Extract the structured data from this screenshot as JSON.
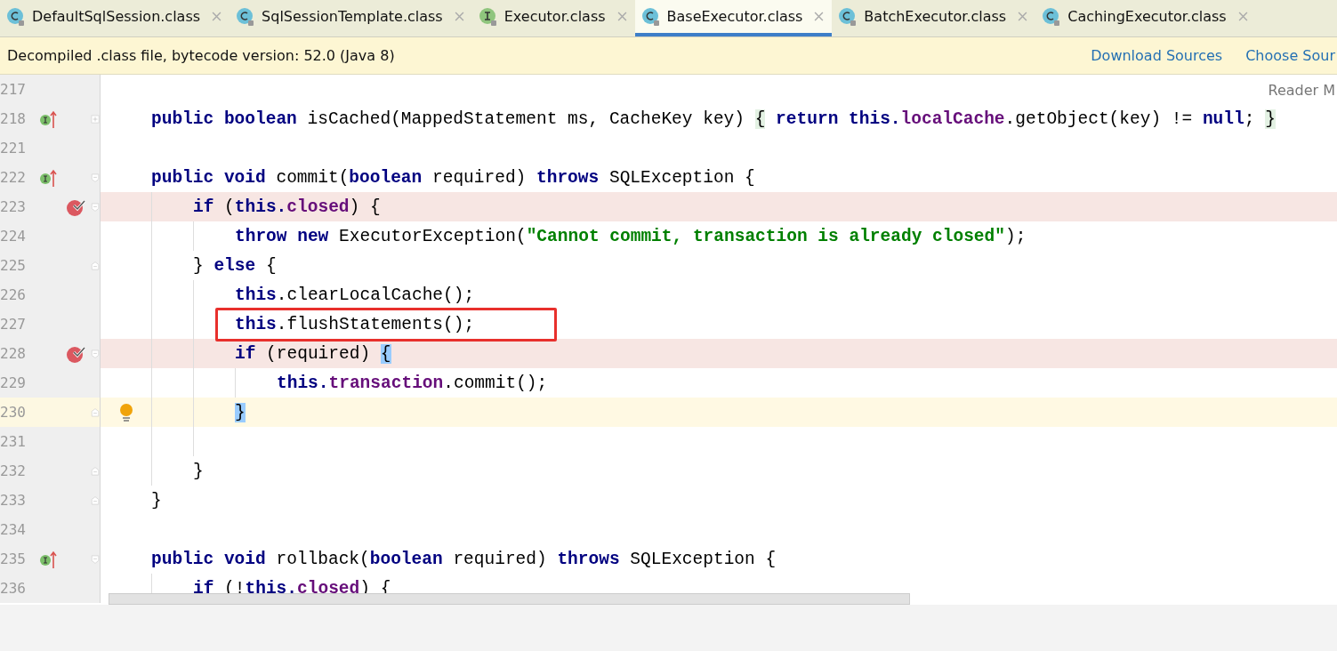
{
  "tabs": [
    {
      "label": "DefaultSqlSession.class",
      "kind": "class",
      "selected": false
    },
    {
      "label": "SqlSessionTemplate.class",
      "kind": "class",
      "selected": false
    },
    {
      "label": "Executor.class",
      "kind": "interface",
      "selected": false
    },
    {
      "label": "BaseExecutor.class",
      "kind": "class",
      "selected": true
    },
    {
      "label": "BatchExecutor.class",
      "kind": "class",
      "selected": false
    },
    {
      "label": "CachingExecutor.class",
      "kind": "class",
      "selected": false
    }
  ],
  "banner": {
    "message": "Decompiled .class file, bytecode version: 52.0 (Java 8)",
    "links": [
      "Download Sources",
      "Choose Sour"
    ]
  },
  "reader_mode": "Reader M",
  "lines": [
    {
      "number": "217",
      "kind": "plain",
      "collapsed": false,
      "block_end": false,
      "current": false,
      "marked": false
    },
    {
      "number": "218",
      "kind": "implements",
      "collapsed": true,
      "block_end": false,
      "current": false,
      "marked": false,
      "tokens": [
        {
          "kind": "kw",
          "text": "public boolean"
        },
        {
          "kind": "plain",
          "text": " isCached(MappedStatement ms, CacheKey key) "
        },
        {
          "kind": "folded",
          "text": "{"
        },
        {
          "kind": "kw",
          "text": " return this."
        },
        {
          "kind": "field",
          "text": "localCache"
        },
        {
          "kind": "plain",
          "text": ".getObject(key) != "
        },
        {
          "kind": "kw",
          "text": "null"
        },
        {
          "kind": "plain",
          "text": "; "
        },
        {
          "kind": "folded",
          "text": "}"
        }
      ]
    },
    {
      "number": "221",
      "kind": "plain",
      "collapsed": false,
      "block_end": false,
      "current": false,
      "marked": false
    },
    {
      "number": "222",
      "kind": "implements",
      "collapsed": false,
      "block_end": false,
      "current": false,
      "marked": false,
      "tokens": [
        {
          "kind": "kw",
          "text": "public void"
        },
        {
          "kind": "plain",
          "text": " commit("
        },
        {
          "kind": "kw",
          "text": "boolean"
        },
        {
          "kind": "plain",
          "text": " required) "
        },
        {
          "kind": "kw",
          "text": "throws"
        },
        {
          "kind": "plain",
          "text": " SQLException {"
        }
      ],
      "children": [
        {
          "number": "223",
          "kind": "breakpoint",
          "collapsed": false,
          "block_end": false,
          "current": false,
          "marked": false,
          "tokens": [
            {
              "kind": "kw",
              "text": "if"
            },
            {
              "kind": "plain",
              "text": " ("
            },
            {
              "kind": "kw",
              "text": "this."
            },
            {
              "kind": "field",
              "text": "closed"
            },
            {
              "kind": "plain",
              "text": ") {"
            }
          ],
          "children": [
            {
              "number": "224",
              "kind": "plain",
              "collapsed": false,
              "block_end": false,
              "current": false,
              "marked": false,
              "tokens": [
                {
                  "kind": "kw",
                  "text": "throw new"
                },
                {
                  "kind": "plain",
                  "text": " ExecutorException("
                },
                {
                  "kind": "string",
                  "text": "\"Cannot commit, transaction is already closed\""
                },
                {
                  "kind": "plain",
                  "text": ");"
                }
              ]
            }
          ]
        },
        {
          "number": "225",
          "kind": "plain",
          "collapsed": false,
          "block_end": true,
          "current": false,
          "marked": false,
          "tokens": [
            {
              "kind": "plain",
              "text": "} "
            },
            {
              "kind": "kw",
              "text": "else"
            },
            {
              "kind": "plain",
              "text": " {"
            }
          ],
          "children": [
            {
              "number": "226",
              "kind": "plain",
              "collapsed": false,
              "block_end": false,
              "current": false,
              "marked": false,
              "tokens": [
                {
                  "kind": "kw",
                  "text": "this"
                },
                {
                  "kind": "plain",
                  "text": ".clearLocalCache();"
                }
              ]
            },
            {
              "number": "227",
              "kind": "plain",
              "collapsed": false,
              "block_end": false,
              "current": false,
              "marked": true,
              "tokens": [
                {
                  "kind": "kw",
                  "text": "this"
                },
                {
                  "kind": "plain",
                  "text": ".flushStatements();"
                }
              ]
            },
            {
              "number": "228",
              "kind": "breakpoint",
              "collapsed": false,
              "block_end": false,
              "current": false,
              "marked": false,
              "tokens": [
                {
                  "kind": "kw",
                  "text": "if"
                },
                {
                  "kind": "plain",
                  "text": " (required) "
                },
                {
                  "kind": "match",
                  "text": "{"
                }
              ],
              "children": [
                {
                  "number": "229",
                  "kind": "plain",
                  "collapsed": false,
                  "block_end": false,
                  "current": false,
                  "marked": false,
                  "tokens": [
                    {
                      "kind": "kw",
                      "text": "this."
                    },
                    {
                      "kind": "field",
                      "text": "transaction"
                    },
                    {
                      "kind": "plain",
                      "text": ".commit();"
                    }
                  ]
                }
              ]
            },
            {
              "number": "230",
              "kind": "bulb",
              "collapsed": false,
              "block_end": true,
              "current": true,
              "marked": false,
              "tokens": [
                {
                  "kind": "match",
                  "text": "}"
                }
              ]
            },
            {
              "number": "231",
              "kind": "plain",
              "collapsed": false,
              "block_end": false,
              "current": false,
              "marked": false
            }
          ]
        },
        {
          "number": "232",
          "kind": "plain",
          "collapsed": false,
          "block_end": true,
          "current": false,
          "marked": false,
          "tokens": [
            {
              "kind": "plain",
              "text": "}"
            }
          ]
        }
      ]
    },
    {
      "number": "233",
      "kind": "plain",
      "collapsed": false,
      "block_end": true,
      "current": false,
      "marked": false,
      "tokens": [
        {
          "kind": "plain",
          "text": "}"
        }
      ]
    },
    {
      "number": "234",
      "kind": "plain",
      "collapsed": false,
      "block_end": false,
      "current": false,
      "marked": false
    },
    {
      "number": "235",
      "kind": "implements",
      "collapsed": false,
      "block_end": false,
      "current": false,
      "marked": false,
      "tokens": [
        {
          "kind": "kw",
          "text": "public void"
        },
        {
          "kind": "plain",
          "text": " rollback("
        },
        {
          "kind": "kw",
          "text": "boolean"
        },
        {
          "kind": "plain",
          "text": " required) "
        },
        {
          "kind": "kw",
          "text": "throws"
        },
        {
          "kind": "plain",
          "text": " SQLException {"
        }
      ],
      "children": [
        {
          "number": "236",
          "kind": "plain",
          "collapsed": false,
          "block_end": false,
          "current": false,
          "marked": false,
          "tokens": [
            {
              "kind": "kw",
              "text": "if"
            },
            {
              "kind": "plain",
              "text": " (!"
            },
            {
              "kind": "kw",
              "text": "this."
            },
            {
              "kind": "field",
              "text": "closed"
            },
            {
              "kind": "plain",
              "text": ") {"
            }
          ]
        }
      ]
    }
  ]
}
